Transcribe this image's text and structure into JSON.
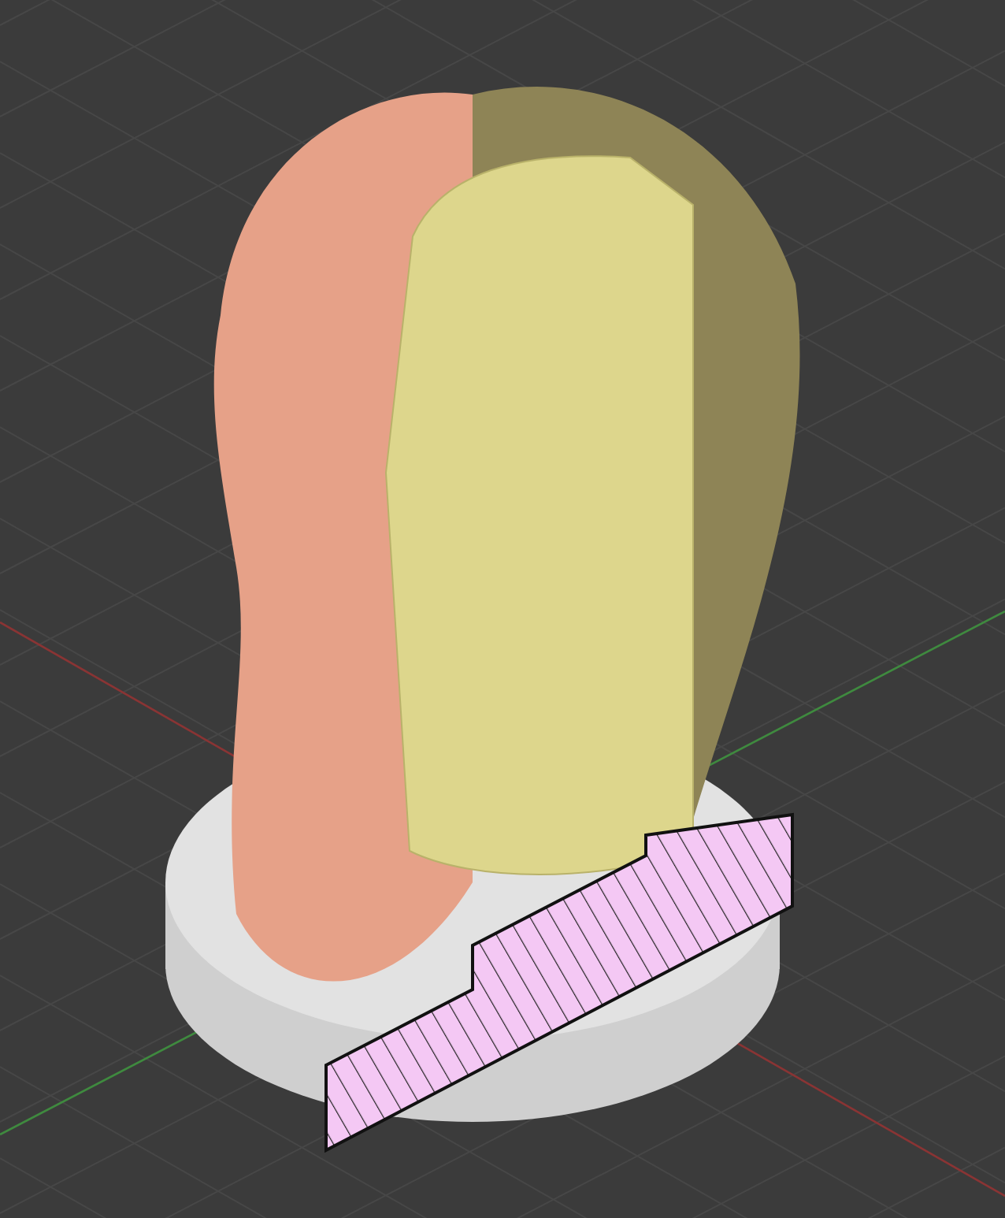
{
  "viewport": {
    "axes": {
      "x_axis": true,
      "y_axis": true
    }
  },
  "model": {
    "kind": "section-view"
  }
}
